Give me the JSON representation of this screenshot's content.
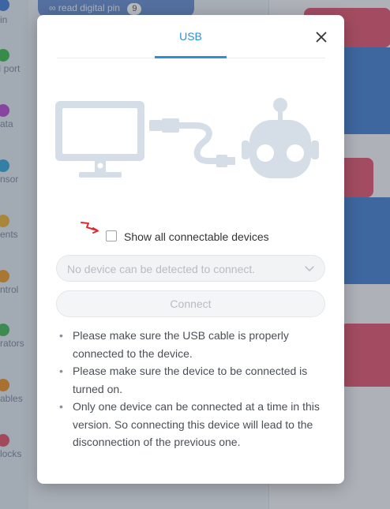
{
  "background": {
    "top_block_label": "read digital pin",
    "top_block_value": "9",
    "categories": [
      {
        "label": "in",
        "color": "#4a7fd6"
      },
      {
        "label": "I port",
        "color": "#3fb950"
      },
      {
        "label": "ata",
        "color": "#b84fd0"
      },
      {
        "label": "nsor",
        "color": "#3aa6d8"
      },
      {
        "label": "ents",
        "color": "#e8b13a"
      },
      {
        "label": "ntrol",
        "color": "#e89a2e"
      },
      {
        "label": "rators",
        "color": "#48b85a"
      },
      {
        "label": "ables",
        "color": "#e8912e"
      },
      {
        "label": "locks",
        "color": "#e0566e"
      }
    ]
  },
  "dialog": {
    "tab_usb": "USB",
    "close_icon": "close-icon",
    "show_all_label": "Show all connectable devices",
    "show_all_checked": false,
    "device_select_placeholder": "No device can be detected to connect.",
    "connect_label": "Connect",
    "tips": [
      "Please make sure the USB cable is properly connected to the device.",
      "Please make sure the device to be connected is turned on.",
      "Only one device can be connected at a time in this version. So connecting this device will lead to the disconnection of the previous one."
    ],
    "accent_color": "#2d8fd8",
    "illustration_icons": [
      "computer-monitor-icon",
      "usb-cable-icon",
      "robot-head-icon"
    ]
  }
}
